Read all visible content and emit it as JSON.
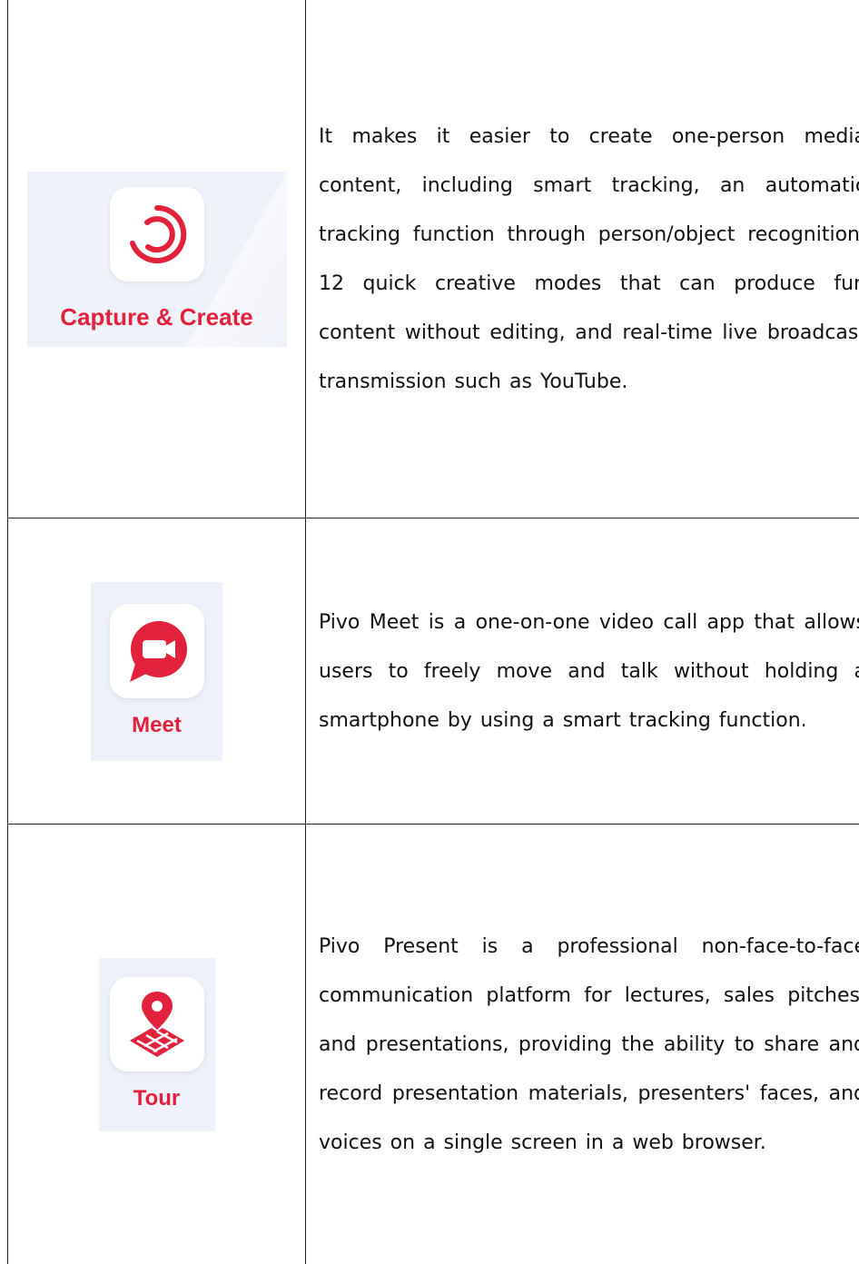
{
  "colors": {
    "accent": "#e2223c",
    "tile_background": "#eef1f9",
    "border": "#222222"
  },
  "rows": [
    {
      "app_name": "Capture & Create",
      "icon": "capture-swirl-icon",
      "description": "It makes it easier to create one-person media content, including smart tracking, an automatic tracking function through person/object recognition, 12 quick creative modes that can produce fun content without editing, and real-time live broadcast transmission such as YouTube."
    },
    {
      "app_name": "Meet",
      "icon": "video-chat-icon",
      "description": "Pivo Meet is a one-on-one video call app that allows users to freely move and talk without holding a smartphone by using a smart tracking function."
    },
    {
      "app_name": "Tour",
      "icon": "map-pin-icon",
      "description": "Pivo Present is a professional non-face-to-face communication platform for lectures, sales pitches, and presentations, providing the ability to share and record presentation materials, presenters' faces, and voices on a single screen in a web browser."
    }
  ]
}
